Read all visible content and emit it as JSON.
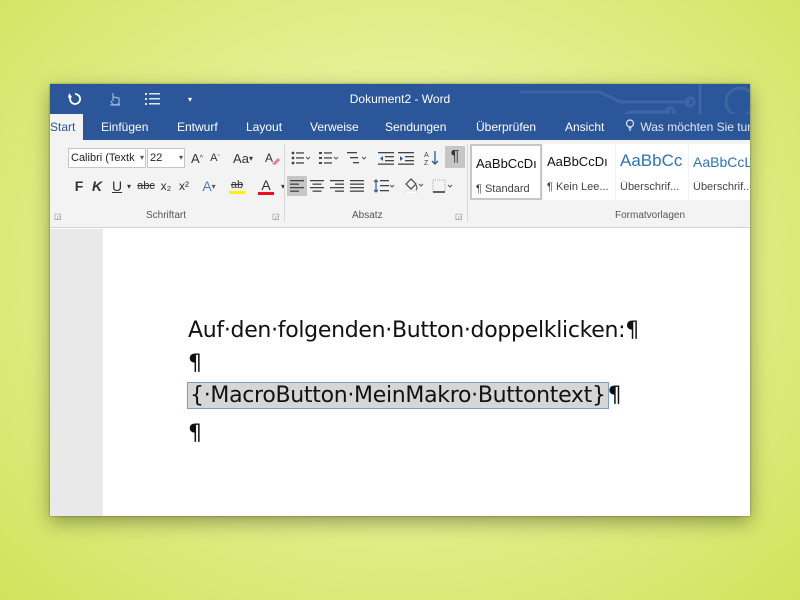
{
  "window": {
    "title": "Dokument2 - Word"
  },
  "qat": {
    "undo_icon": "undo-icon",
    "touch_icon": "touch-mode-icon",
    "list_icon": "list-icon",
    "customize_icon": "chevron-down-icon"
  },
  "tabs": [
    "Start",
    "Einfügen",
    "Entwurf",
    "Layout",
    "Verweise",
    "Sendungen",
    "Überprüfen",
    "Ansicht"
  ],
  "tell_me": "Was möchten Sie tun",
  "font": {
    "family": "Calibri (Textk",
    "size": "22"
  },
  "font_buttons": {
    "grow": "A",
    "shrink": "A",
    "case": "Aa",
    "bold": "F",
    "italic": "K",
    "underline": "U",
    "strike": "abc",
    "subscript": "x₂",
    "superscript": "x²",
    "effects": "A",
    "highlight": "ab",
    "fontcolor": "A"
  },
  "groups": {
    "font": "Schriftart",
    "paragraph": "Absatz",
    "styles": "Formatvorlagen"
  },
  "styles": [
    {
      "sample": "AaBbCcDı",
      "name": "¶ Standard"
    },
    {
      "sample": "AaBbCcDı",
      "name": "¶ Kein Lee..."
    },
    {
      "sample": "AaBbCc",
      "name": "Überschrif..."
    },
    {
      "sample": "AaBbCcL",
      "name": "Überschrif..."
    }
  ],
  "colors": {
    "accent": "#2b579a",
    "font_color_bar": "#e81123"
  },
  "document": {
    "line1": "Auf·den·folgenden·Button·doppelklicken:¶",
    "line2": "¶",
    "field_open": "{",
    "field_code": "·MacroButton·MeinMakro·Buttontext",
    "field_close": "}",
    "line3_tail": "¶",
    "line4": "¶"
  }
}
